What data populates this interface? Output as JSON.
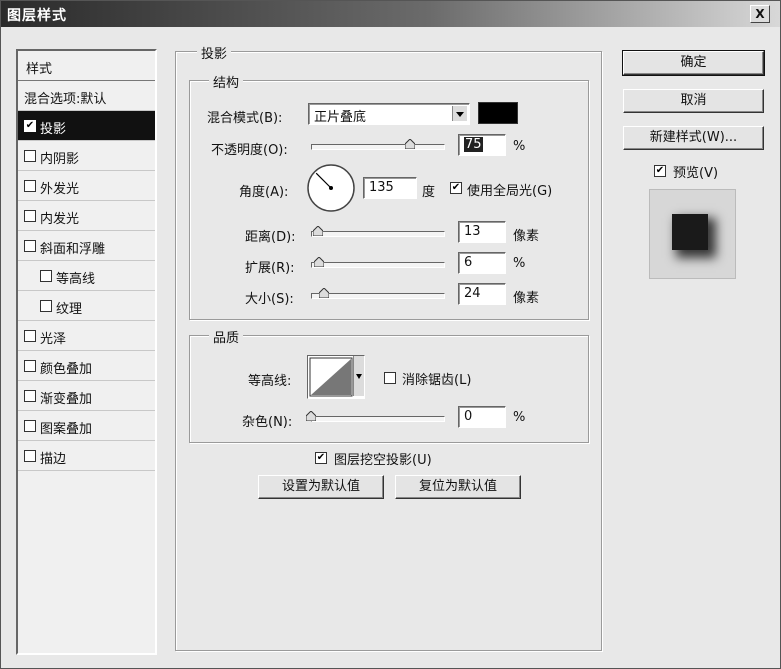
{
  "window": {
    "title": "图层样式",
    "close_label": "X"
  },
  "styles_list": {
    "header": "样式",
    "items": [
      {
        "label": "混合选项:默认",
        "checkbox": false,
        "checked": false,
        "selected": false
      },
      {
        "label": "投影",
        "checkbox": true,
        "checked": true,
        "selected": true
      },
      {
        "label": "内阴影",
        "checkbox": true,
        "checked": false,
        "selected": false
      },
      {
        "label": "外发光",
        "checkbox": true,
        "checked": false,
        "selected": false
      },
      {
        "label": "内发光",
        "checkbox": true,
        "checked": false,
        "selected": false
      },
      {
        "label": "斜面和浮雕",
        "checkbox": true,
        "checked": false,
        "selected": false
      },
      {
        "label": "等高线",
        "checkbox": true,
        "checked": false,
        "selected": false
      },
      {
        "label": "纹理",
        "checkbox": true,
        "checked": false,
        "selected": false
      },
      {
        "label": "光泽",
        "checkbox": true,
        "checked": false,
        "selected": false
      },
      {
        "label": "颜色叠加",
        "checkbox": true,
        "checked": false,
        "selected": false
      },
      {
        "label": "渐变叠加",
        "checkbox": true,
        "checked": false,
        "selected": false
      },
      {
        "label": "图案叠加",
        "checkbox": true,
        "checked": false,
        "selected": false
      },
      {
        "label": "描边",
        "checkbox": true,
        "checked": false,
        "selected": false
      }
    ]
  },
  "drop_shadow": {
    "title": "投影",
    "structure": {
      "title": "结构",
      "blend_mode": {
        "label": "混合模式(B):",
        "value": "正片叠底",
        "color": "#000000"
      },
      "opacity": {
        "label": "不透明度(O):",
        "value": "75",
        "unit": "%",
        "slider_fraction": 0.75
      },
      "angle": {
        "label": "角度(A):",
        "value": "135",
        "unit": "度",
        "degrees": 135
      },
      "use_global_light": {
        "label": "使用全局光(G)",
        "checked": true
      },
      "distance": {
        "label": "距离(D):",
        "value": "13",
        "unit": "像素",
        "slider_fraction": 0.05
      },
      "spread": {
        "label": "扩展(R):",
        "value": "6",
        "unit": "%",
        "slider_fraction": 0.06
      },
      "size": {
        "label": "大小(S):",
        "value": "24",
        "unit": "像素",
        "slider_fraction": 0.1
      }
    },
    "quality": {
      "title": "品质",
      "contour": {
        "label": "等高线:"
      },
      "anti_aliased": {
        "label": "消除锯齿(L)",
        "checked": false
      },
      "noise": {
        "label": "杂色(N):",
        "value": "0",
        "unit": "%",
        "slider_fraction": 0.0
      }
    },
    "knockout": {
      "label": "图层挖空投影(U)",
      "checked": true
    },
    "make_default_button": "设置为默认值",
    "reset_default_button": "复位为默认值"
  },
  "actions": {
    "ok": "确定",
    "cancel": "取消",
    "new_style": "新建样式(W)...",
    "preview": {
      "label": "预览(V)",
      "checked": true
    }
  },
  "colors": {
    "selected_row": "#111111",
    "dialog_bg": "#e8e8e8"
  }
}
